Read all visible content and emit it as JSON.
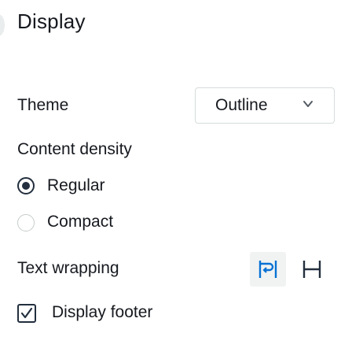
{
  "panel": {
    "title": "Display"
  },
  "theme": {
    "label": "Theme",
    "selected": "Outline",
    "chevron_icon": "chevron-down-icon"
  },
  "density": {
    "label": "Content density",
    "options": [
      {
        "label": "Regular",
        "selected": true
      },
      {
        "label": "Compact",
        "selected": false
      }
    ]
  },
  "wrapping": {
    "label": "Text wrapping",
    "options": [
      {
        "icon": "text-wrap-icon",
        "selected": true
      },
      {
        "icon": "text-no-wrap-icon",
        "selected": false
      }
    ]
  },
  "footer": {
    "label": "Display footer",
    "checked": true
  },
  "colors": {
    "text": "#16191f",
    "control_dark": "#232f3e",
    "border": "#d5dbdb",
    "segment_selected_bg": "#f1f3f3",
    "segment_selected_icon": "#0972d3"
  }
}
